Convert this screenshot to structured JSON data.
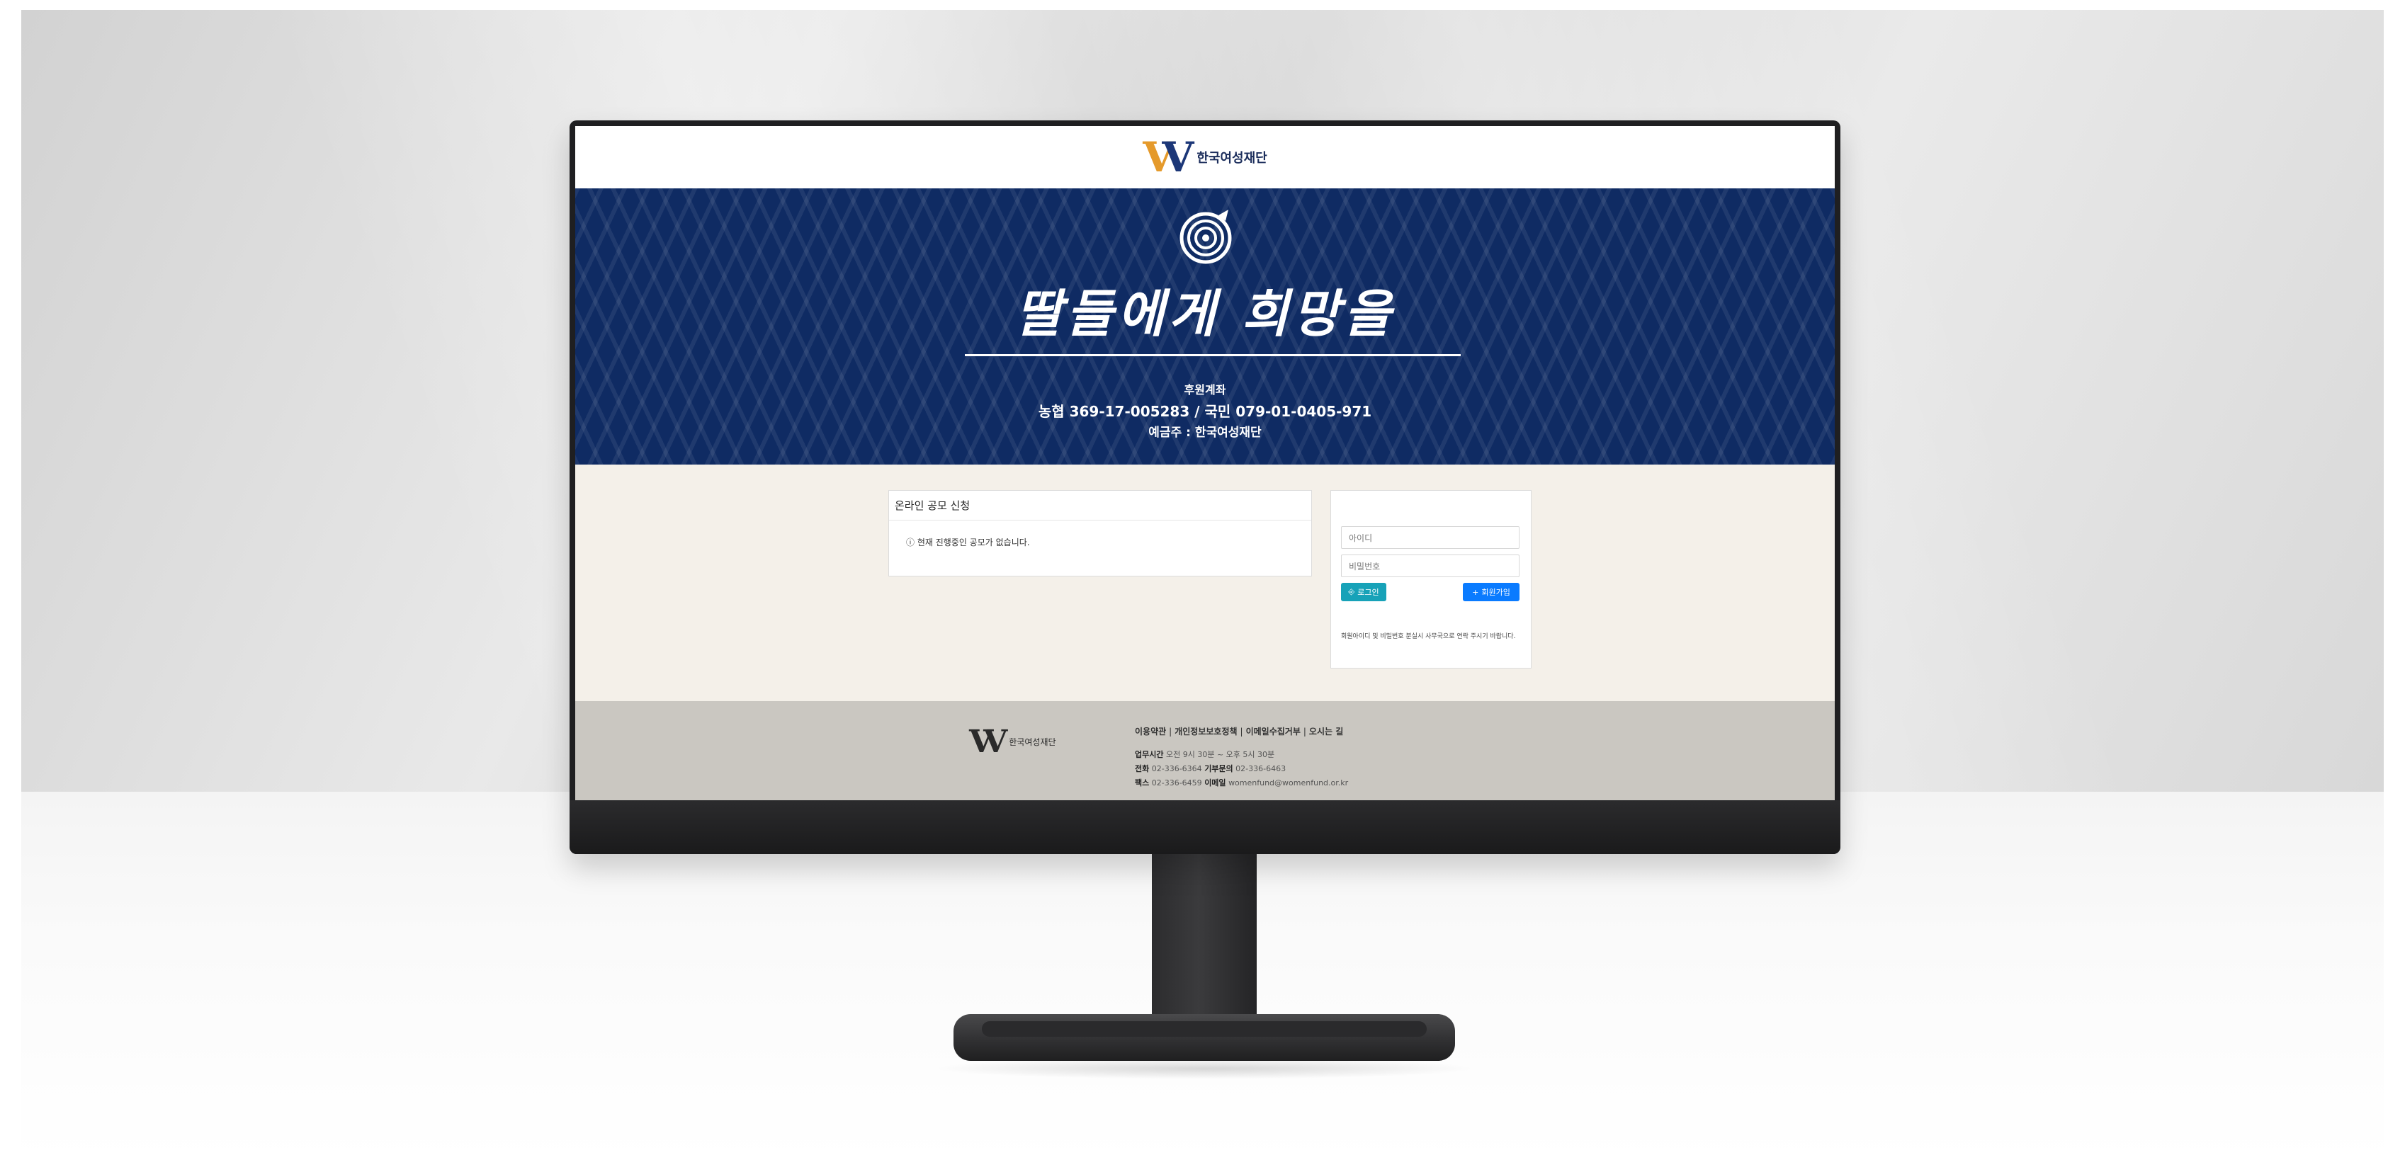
{
  "site": {
    "logo_text": "한국여성재단",
    "logo_mark": "W",
    "banner": {
      "calligraphy": "딸들에게 희망을",
      "title": "후원계좌",
      "account": "농협 369-17-005283 / 국민 079-01-0405-971",
      "owner": "예금주 : 한국여성재단"
    },
    "apply_card": {
      "title": "온라인 공모 신청",
      "message": "ⓘ 현재 진행중인 공모가 없습니다."
    },
    "login": {
      "id_placeholder": "아이디",
      "pw_placeholder": "비밀번호",
      "login_button": "로그인",
      "join_button": "회원가입",
      "note": "회원아이디 및 비밀번호 분실시 사무국으로 연락 주시기 바랍니다."
    },
    "footer": {
      "logo_text": "한국여성재단",
      "links": [
        "이용약관",
        "개인정보보호정책",
        "이메일수집거부",
        "오시는 길"
      ],
      "hours_label": "업무시간",
      "hours": "오전 9시 30분 ~ 오후 5시 30분",
      "phone_label": "전화",
      "phone": "02-336-6364",
      "donate_label": "기부문의",
      "donate_phone": "02-336-6463",
      "fax_label": "팩스",
      "fax": "02-336-6459",
      "email_label": "이메일",
      "email": "womenfund@womenfund.or.kr"
    }
  },
  "colors": {
    "banner_navy": "#0f2b63",
    "logo_orange": "#e59a2b",
    "login_button": "#17a2b8",
    "join_button": "#0a7bff"
  }
}
